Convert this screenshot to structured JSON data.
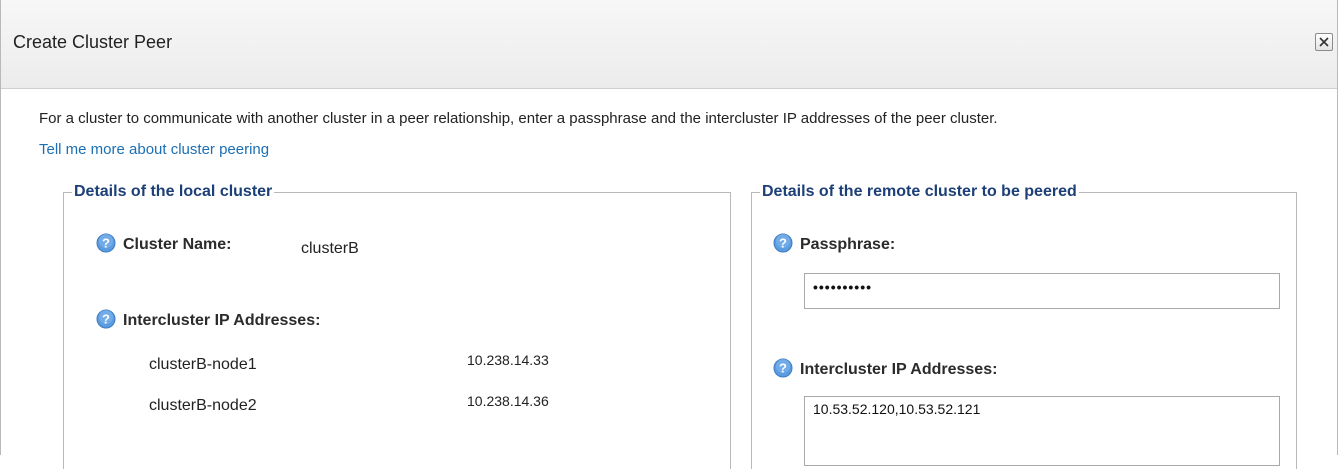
{
  "dialog": {
    "title": "Create Cluster Peer",
    "close_icon": "close-icon"
  },
  "intro": {
    "text": "For a cluster to communicate with another cluster in a peer relationship, enter a passphrase and the intercluster IP addresses of the peer cluster.",
    "link": "Tell me more about cluster peering"
  },
  "local": {
    "legend": "Details of the local cluster",
    "cluster_name_label": "Cluster Name:",
    "cluster_name_value": "clusterB",
    "ip_label": "Intercluster IP Addresses:",
    "nodes": [
      {
        "name": "clusterB-node1",
        "ip": "10.238.14.33"
      },
      {
        "name": "clusterB-node2",
        "ip": "10.238.14.36"
      }
    ]
  },
  "remote": {
    "legend": "Details of the remote cluster to be peered",
    "passphrase_label": "Passphrase:",
    "passphrase_value": "••••••••••",
    "ip_label": "Intercluster IP Addresses:",
    "ip_value": "10.53.52.120,10.53.52.121"
  },
  "icons": {
    "help": "help-icon",
    "close": "close-icon"
  },
  "colors": {
    "legend": "#1c3f77",
    "link": "#1b6fb4",
    "help_icon": "#4d8fd1"
  }
}
